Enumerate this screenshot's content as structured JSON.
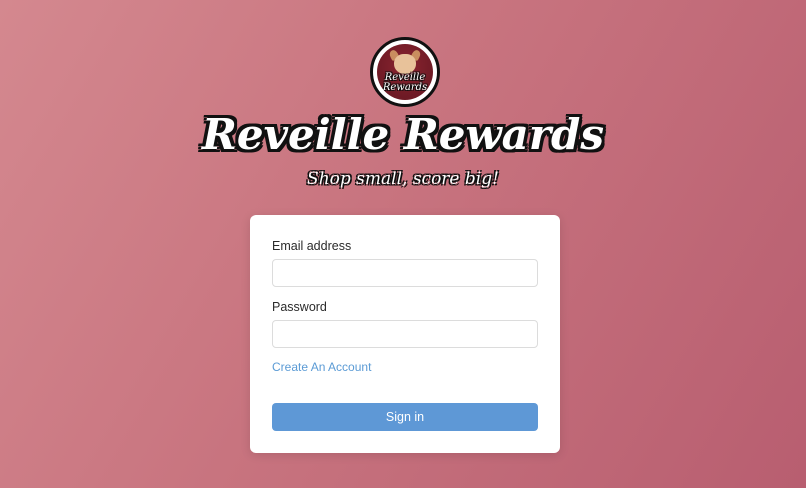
{
  "brand": {
    "logo_text_line1": "Reveille",
    "logo_text_line2": "Rewards",
    "title": "Reveille Rewards",
    "tagline": "Shop small, score big!"
  },
  "login_form": {
    "email_label": "Email address",
    "email_value": "",
    "email_placeholder": "",
    "password_label": "Password",
    "password_value": "",
    "password_placeholder": "",
    "create_account_link": "Create An Account",
    "sign_in_button": "Sign in"
  },
  "colors": {
    "background_start": "#d4888f",
    "background_end": "#b85e70",
    "accent_button": "#5e98d6",
    "link": "#5b9bd5"
  },
  "icons": {
    "logo": "dog-mascot-icon"
  }
}
